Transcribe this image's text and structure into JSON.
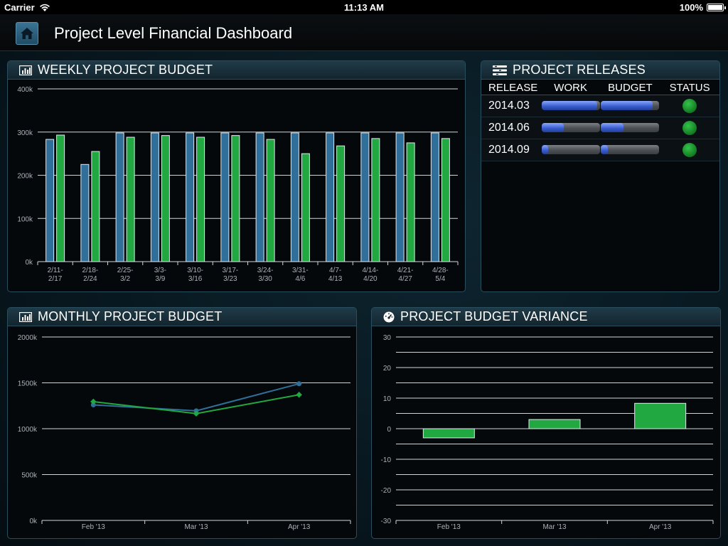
{
  "status_bar": {
    "carrier": "Carrier",
    "time": "11:13 AM",
    "battery": "100%"
  },
  "nav": {
    "title": "Project Level Financial Dashboard",
    "home_icon": "home-icon"
  },
  "colors": {
    "blue_series": "#2f6f99",
    "green_series": "#21a840",
    "accent": "#2b4e5e"
  },
  "weekly": {
    "title": "WEEKLY PROJECT BUDGET",
    "icon": "bar-chart-icon"
  },
  "releases": {
    "title": "PROJECT RELEASES",
    "icon": "list-icon",
    "headers": [
      "RELEASE",
      "WORK",
      "BUDGET",
      "STATUS"
    ],
    "rows": [
      {
        "release": "2014.03",
        "work": 0.95,
        "budget": 0.88,
        "status": "green"
      },
      {
        "release": "2014.06",
        "work": 0.38,
        "budget": 0.38,
        "status": "green"
      },
      {
        "release": "2014.09",
        "work": 0.12,
        "budget": 0.12,
        "status": "green"
      }
    ]
  },
  "monthly": {
    "title": "MONTHLY PROJECT BUDGET",
    "icon": "bar-chart-icon"
  },
  "variance": {
    "title": "PROJECT BUDGET VARIANCE",
    "icon": "speedometer-icon"
  },
  "chart_data": [
    {
      "type": "bar",
      "categories": [
        [
          "2/11-",
          "2/17"
        ],
        [
          "2/18-",
          "2/24"
        ],
        [
          "2/25-",
          "3/2"
        ],
        [
          "3/3-",
          "3/9"
        ],
        [
          "3/10-",
          "3/16"
        ],
        [
          "3/17-",
          "3/23"
        ],
        [
          "3/24-",
          "3/30"
        ],
        [
          "3/31-",
          "4/6"
        ],
        [
          "4/7-",
          "4/13"
        ],
        [
          "4/14-",
          "4/20"
        ],
        [
          "4/21-",
          "4/27"
        ],
        [
          "4/28-",
          "5/4"
        ]
      ],
      "series": [
        {
          "values": [
            283,
            225,
            298,
            298,
            298,
            298,
            298,
            298,
            298,
            298,
            298,
            298
          ]
        },
        {
          "values": [
            293,
            255,
            288,
            292,
            288,
            292,
            283,
            250,
            268,
            285,
            275,
            285
          ]
        }
      ],
      "yticks": [
        "0k",
        "100k",
        "200k",
        "300k",
        "400k"
      ],
      "ylim": [
        0,
        400
      ],
      "grid": true
    },
    {
      "type": "line",
      "categories": [
        "Feb '13",
        "Mar '13",
        "Apr '13"
      ],
      "series": [
        {
          "values": [
            1260,
            1195,
            1490
          ]
        },
        {
          "values": [
            1295,
            1165,
            1370
          ]
        }
      ],
      "yticks": [
        "0k",
        "500k",
        "1000k",
        "1500k",
        "2000k"
      ],
      "ylim": [
        0,
        2000
      ],
      "grid": true
    },
    {
      "type": "bar",
      "categories": [
        "Feb '13",
        "Mar '13",
        "Apr '13"
      ],
      "values": [
        -3,
        3,
        8.3
      ],
      "yticks": [
        "-30",
        "-20",
        "-10",
        "0",
        "10",
        "20",
        "30"
      ],
      "ylim": [
        -30,
        30
      ],
      "grid": true
    }
  ]
}
